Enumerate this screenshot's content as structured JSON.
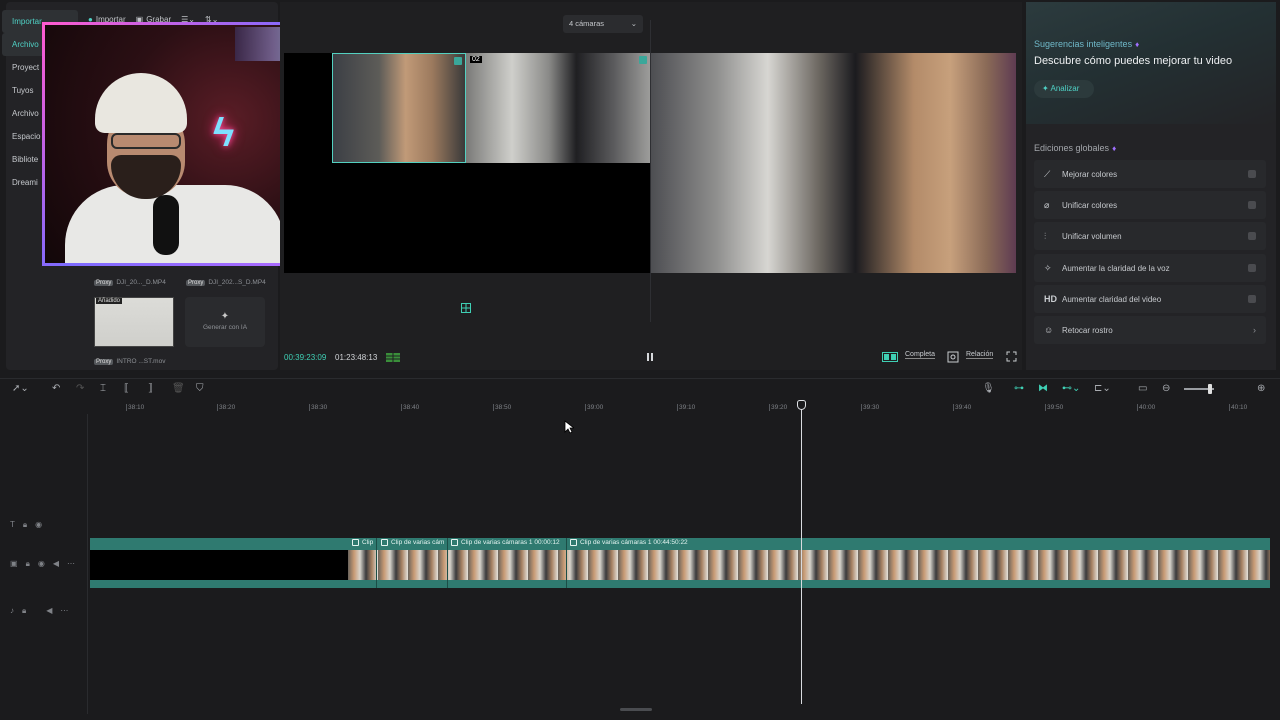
{
  "left_panel": {
    "nav_items": [
      "Importar",
      "Archivo",
      "Proyect",
      "Tuyos",
      "Archivo",
      "Espacio",
      "Bibliote",
      "Dreami"
    ],
    "toolbar": {
      "import_label": "Importar",
      "record_label": "Grabar"
    },
    "media": [
      {
        "proxy": "Proxy",
        "caption": "DJI_20..._D.MP4"
      },
      {
        "proxy": "Proxy",
        "caption": "DJI_202...S_D.MP4"
      }
    ],
    "intro_badge": "Añadido",
    "intro_proxy": "Proxy",
    "intro_caption": "INTRO ...ST.mov",
    "generate_ai": "Generar con IA"
  },
  "player": {
    "camera_select": "4 cámaras",
    "cam2_label": "02",
    "timecode_current": "00:39:23:09",
    "timecode_total": "01:23:48:13",
    "complete_label": "Completa",
    "ratio_label": "Relación"
  },
  "right_panel": {
    "ai_small_title": "Sugerencias inteligentes",
    "ai_title": "Descubre cómo puedes mejorar tu video",
    "analyze_label": "Analizar",
    "global_title": "Ediciones globales",
    "items": [
      {
        "icon": "magic-wand-icon",
        "label": "Mejorar colores"
      },
      {
        "icon": "brush-icon",
        "label": "Unificar colores"
      },
      {
        "icon": "sliders-icon",
        "label": "Unificar volumen"
      },
      {
        "icon": "sparkle-voice-icon",
        "label": "Aumentar la claridad de la voz"
      },
      {
        "icon": "hd-icon",
        "label": "Aumentar claridad del video"
      },
      {
        "icon": "face-retouch-icon",
        "label": "Retocar rostro"
      }
    ]
  },
  "timeline": {
    "ruler_labels": [
      "38:10",
      "38:20",
      "38:30",
      "38:40",
      "38:50",
      "39:00",
      "39:10",
      "39:20",
      "39:30",
      "39:40",
      "39:50",
      "40:00",
      "40:10"
    ],
    "clips": [
      {
        "label": "Clip"
      },
      {
        "label": "Clip de varias cám"
      },
      {
        "label": "Clip de varias cámaras 1   00:00:12"
      },
      {
        "label": "Clip de varias cámaras 1   00:44:50:22"
      }
    ]
  },
  "colors": {
    "accent": "#4fd1c5",
    "clip_track": "#2f7a70",
    "webcam_border": "#b06bff"
  }
}
